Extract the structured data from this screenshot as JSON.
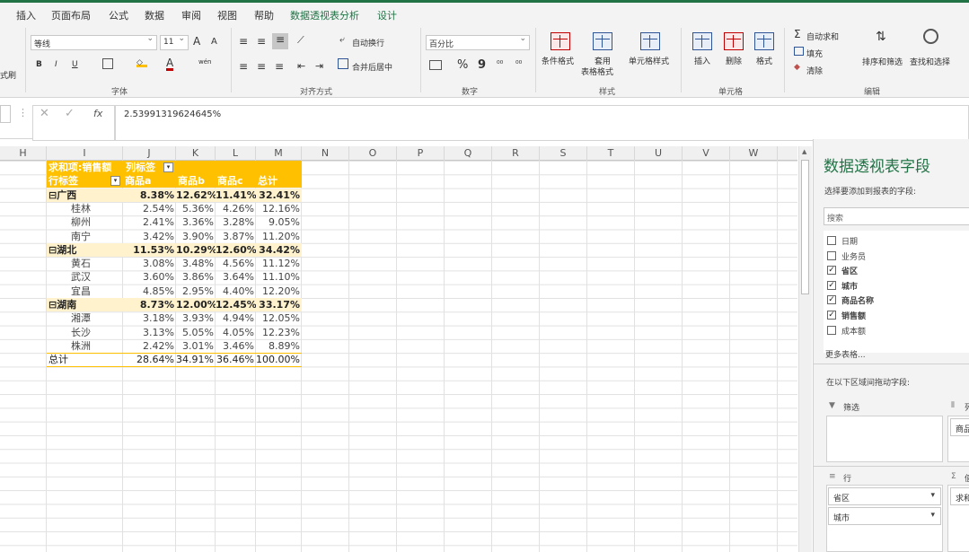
{
  "menu": {
    "tabs": [
      "插入",
      "页面布局",
      "公式",
      "数据",
      "审阅",
      "视图",
      "帮助",
      "数据透视表分析",
      "设计"
    ]
  },
  "ribbon": {
    "font": {
      "name": "等线",
      "size": "11",
      "bold": "B",
      "italic": "I",
      "underline": "U",
      "label": "字体",
      "grow": "A",
      "shrink": "A",
      "color_letter": "A",
      "wen": "wén"
    },
    "align": {
      "wrap": "自动换行",
      "merge": "合并后居中",
      "label": "对齐方式"
    },
    "number": {
      "format": "百分比",
      "percent": "%",
      "comma": "9",
      "label": "数字"
    },
    "styles": {
      "cond": "条件格式",
      "table1": "套用",
      "table2": "表格格式",
      "cell": "单元格样式",
      "label": "样式"
    },
    "cells": {
      "insert": "插入",
      "delete": "删除",
      "format": "格式",
      "label": "单元格"
    },
    "edit": {
      "autosum": "自动求和",
      "fill": "填充",
      "clear": "清除",
      "sort": "排序和筛选",
      "find": "查找和选择",
      "label": "编辑"
    },
    "left_cut": {
      "a": "式刷"
    }
  },
  "formula": {
    "value": "2.53991319624645%",
    "fx": "fx"
  },
  "columns": [
    "H",
    "I",
    "J",
    "K",
    "L",
    "M",
    "N",
    "O",
    "P",
    "Q",
    "R",
    "S",
    "T",
    "U",
    "V",
    "W"
  ],
  "pivot": {
    "hdr1": {
      "a": "求和项:销售额",
      "b": "列标签"
    },
    "hdr2": [
      "行标签",
      "商品a",
      "商品b",
      "商品c",
      "总计"
    ],
    "rows": [
      [
        "⊟广西",
        "8.38%",
        "12.62%",
        "11.41%",
        "32.41%"
      ],
      [
        "桂林",
        "2.54%",
        "5.36%",
        "4.26%",
        "12.16%"
      ],
      [
        "柳州",
        "2.41%",
        "3.36%",
        "3.28%",
        "9.05%"
      ],
      [
        "南宁",
        "3.42%",
        "3.90%",
        "3.87%",
        "11.20%"
      ],
      [
        "⊟湖北",
        "11.53%",
        "10.29%",
        "12.60%",
        "34.42%"
      ],
      [
        "黄石",
        "3.08%",
        "3.48%",
        "4.56%",
        "11.12%"
      ],
      [
        "武汉",
        "3.60%",
        "3.86%",
        "3.64%",
        "11.10%"
      ],
      [
        "宜昌",
        "4.85%",
        "2.95%",
        "4.40%",
        "12.20%"
      ],
      [
        "⊟湖南",
        "8.73%",
        "12.00%",
        "12.45%",
        "33.17%"
      ],
      [
        "湘潭",
        "3.18%",
        "3.93%",
        "4.94%",
        "12.05%"
      ],
      [
        "长沙",
        "3.13%",
        "5.05%",
        "4.05%",
        "12.23%"
      ],
      [
        "株洲",
        "2.42%",
        "3.01%",
        "3.46%",
        "8.89%"
      ],
      [
        "总计",
        "28.64%",
        "34.91%",
        "36.46%",
        "100.00%"
      ]
    ]
  },
  "panel": {
    "title": "数据透视表字段",
    "subtitle": "选择要添加到报表的字段:",
    "search": "搜索",
    "fields": [
      {
        "label": "日期",
        "checked": ""
      },
      {
        "label": "业务员",
        "checked": ""
      },
      {
        "label": "省区",
        "checked": "✓"
      },
      {
        "label": "城市",
        "checked": "✓"
      },
      {
        "label": "商品名称",
        "checked": "✓"
      },
      {
        "label": "销售额",
        "checked": "✓"
      },
      {
        "label": "成本额",
        "checked": ""
      }
    ],
    "more": "更多表格...",
    "drag": "在以下区域间拖动字段:",
    "filter": "筛选",
    "columns_cut": "列",
    "col_item_cut": "商品",
    "rows": "行",
    "values_cut": "值",
    "row_items": [
      "省区",
      "城市"
    ],
    "val_item_cut": "求和"
  }
}
